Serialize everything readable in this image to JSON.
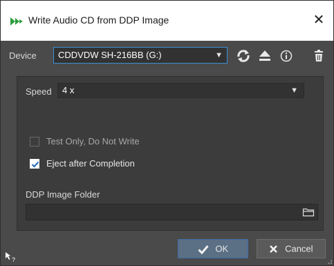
{
  "window": {
    "title": "Write Audio CD from DDP Image",
    "close_glyph": "✕"
  },
  "device": {
    "label": "Device",
    "selected": "CDDVDW SH-216BB (G:)",
    "icons": [
      "refresh-icon",
      "eject-icon",
      "info-icon",
      "trash-icon"
    ]
  },
  "speed": {
    "label": "Speed",
    "selected": "4 x"
  },
  "options": [
    {
      "label": "Test Only, Do Not Write",
      "checked": false
    },
    {
      "label": "Eject after Completion",
      "checked": true
    }
  ],
  "ddp": {
    "label": "DDP Image Folder",
    "value": ""
  },
  "buttons": {
    "ok": "OK",
    "cancel": "Cancel"
  },
  "colors": {
    "accent": "#3c8fd6",
    "background": "#4a4a4a",
    "panel": "#3c3c3c",
    "ok_button": "#5b6f85",
    "app_icon": "#2e9e3e"
  }
}
